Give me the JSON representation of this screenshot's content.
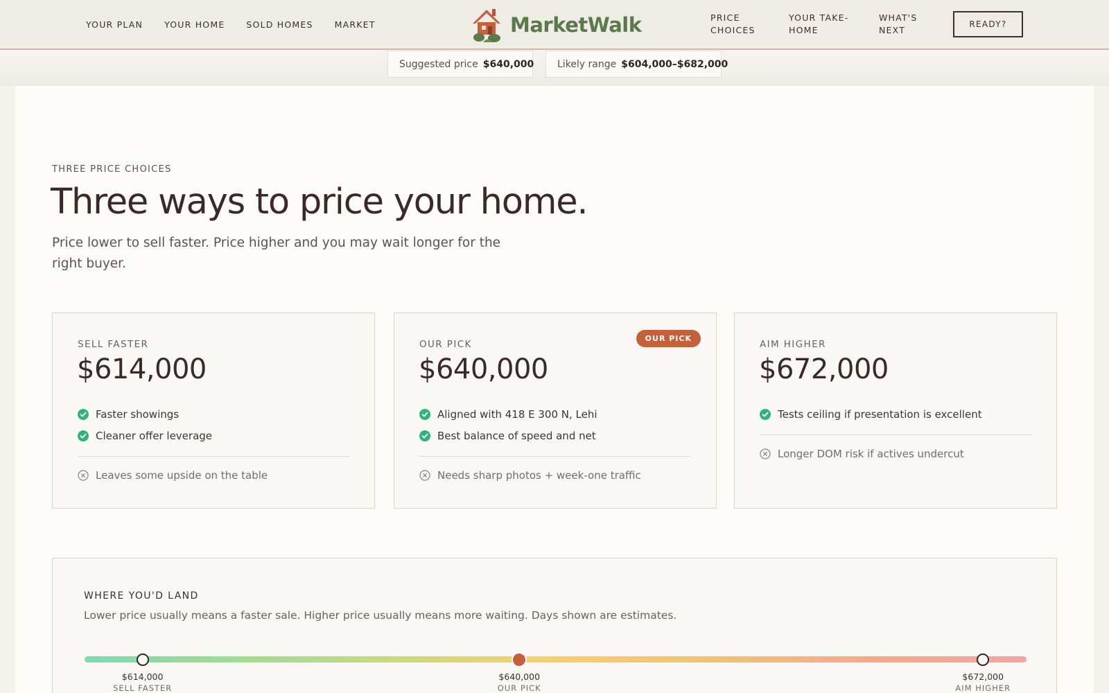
{
  "nav": {
    "left_links": [
      "YOUR PLAN",
      "YOUR HOME",
      "SOLD HOMES",
      "MARKET"
    ],
    "brand": "MarketWalk",
    "right_links": [
      {
        "line1": "PRICE",
        "line2": "CHOICES"
      },
      {
        "line1": "YOUR TAKE-",
        "line2": "HOME"
      },
      {
        "line1": "WHAT'S",
        "line2": "NEXT"
      }
    ],
    "cta": "READY?"
  },
  "price_bar": {
    "suggested_label": "Suggested price",
    "suggested_value": "$640,000",
    "range_label": "Likely range",
    "range_value": "$604,000–$682,000"
  },
  "hero": {
    "eyebrow": "THREE PRICE CHOICES",
    "title": "Three ways to price your home.",
    "subtitle": "Price lower to sell faster. Price higher and you may wait longer for the right buyer."
  },
  "cards": [
    {
      "label": "SELL FASTER",
      "price": "$614,000",
      "pros": [
        "Faster showings",
        "Cleaner offer leverage"
      ],
      "con": "Leaves some upside on the table",
      "badge": ""
    },
    {
      "label": "OUR PICK",
      "price": "$640,000",
      "pros": [
        "Aligned with 418 E 300 N, Lehi",
        "Best balance of speed and net"
      ],
      "con": "Needs sharp photos + week-one traffic",
      "badge": "OUR PICK"
    },
    {
      "label": "AIM HIGHER",
      "price": "$672,000",
      "pros": [
        "Tests ceiling if presentation is excellent"
      ],
      "con": "Longer DOM risk if actives undercut",
      "badge": ""
    }
  ],
  "land": {
    "title": "WHERE YOU'D LAND",
    "subtitle": "Lower price usually means a faster sale. Higher price usually means more waiting. Days shown are estimates.",
    "range_min": 610000,
    "range_max": 675000,
    "markers": [
      {
        "price": "$614,000",
        "value": 614000,
        "name": "SELL FASTER",
        "selected": false
      },
      {
        "price": "$640,000",
        "value": 640000,
        "name": "OUR PICK",
        "selected": true
      },
      {
        "price": "$672,000",
        "value": 672000,
        "name": "AIM HIGHER",
        "selected": false
      }
    ]
  },
  "colors": {
    "accent": "#c4603a",
    "brand_green": "#5a7a4b",
    "check_green": "#2fb37a"
  },
  "icons": [
    "house-logo-icon",
    "check-circle-icon",
    "x-circle-icon"
  ]
}
